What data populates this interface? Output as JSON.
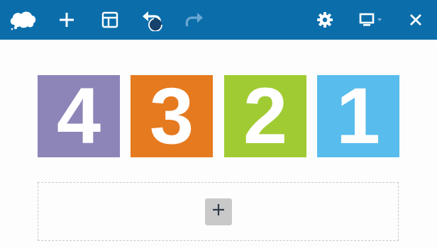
{
  "toolbar": {
    "background": "#0b6eab",
    "icons": [
      "cloud-logo-icon",
      "plus-icon",
      "layout-icon",
      "undo-icon",
      "redo-icon",
      "gear-icon",
      "monitor-icon",
      "close-icon"
    ]
  },
  "tiles": [
    {
      "label": "4",
      "color": "#8d84b8"
    },
    {
      "label": "3",
      "color": "#e67a1f"
    },
    {
      "label": "2",
      "color": "#a1cb33"
    },
    {
      "label": "1",
      "color": "#58bcec"
    }
  ]
}
